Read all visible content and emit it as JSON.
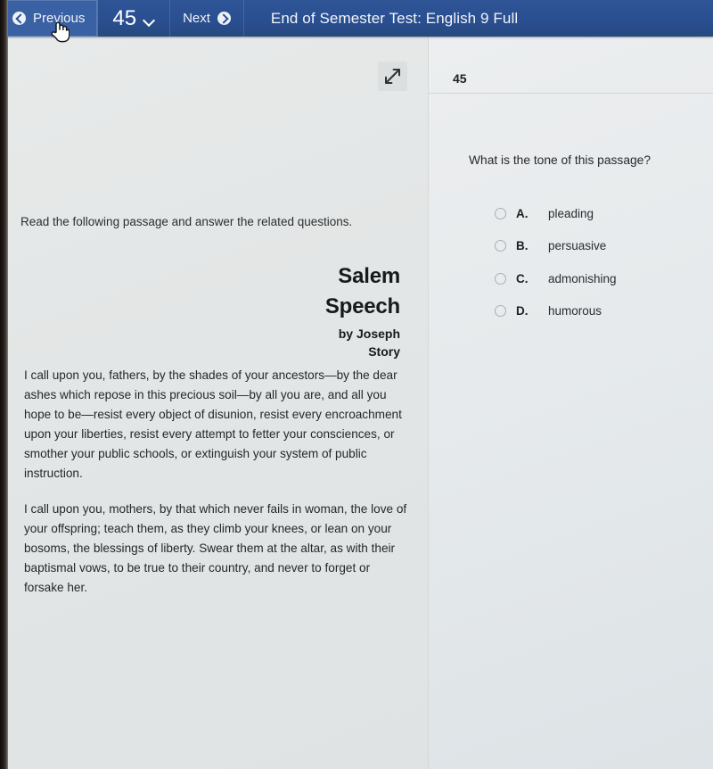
{
  "toolbar": {
    "previous_label": "Previous",
    "previous_icon": "circle-left-arrow-icon",
    "question_number": "45",
    "dropdown_icon": "chevron-down-icon",
    "next_label": "Next",
    "next_icon": "circle-right-arrow-icon",
    "title": "End of Semester Test: English 9 Full",
    "background_color": "#2a4f91",
    "hover_color": "#3a61a4"
  },
  "left_pane": {
    "expand_icon": "expand-diagonal-arrows-icon",
    "instructions": "Read the following passage and answer the related questions.",
    "passage": {
      "title_line1": "Salem",
      "title_line2": "Speech",
      "byline_line1": "by Joseph",
      "byline_line2": "Story",
      "paragraphs": [
        "I call upon you, fathers, by the shades of your ancestors—by the dear ashes which repose in this precious soil—by all you are, and all you hope to be—resist every object of disunion, resist every encroachment upon your liberties, resist every attempt to fetter your consciences, or smother your public schools, or extinguish your system of public instruction.",
        "I call upon you, mothers, by that which never fails in woman, the love of your offspring; teach them, as they climb your knees, or lean on your bosoms, the blessings of liberty. Swear them at the altar, as with their baptismal vows, to be true to their country, and never to forget or forsake her."
      ]
    }
  },
  "right_pane": {
    "question_number": "45",
    "question_text": "What is the tone of this passage?",
    "choices": [
      {
        "letter": "A.",
        "text": "pleading",
        "selected": false
      },
      {
        "letter": "B.",
        "text": "persuasive",
        "selected": false
      },
      {
        "letter": "C.",
        "text": "admonishing",
        "selected": false
      },
      {
        "letter": "D.",
        "text": "humorous",
        "selected": false
      }
    ]
  }
}
